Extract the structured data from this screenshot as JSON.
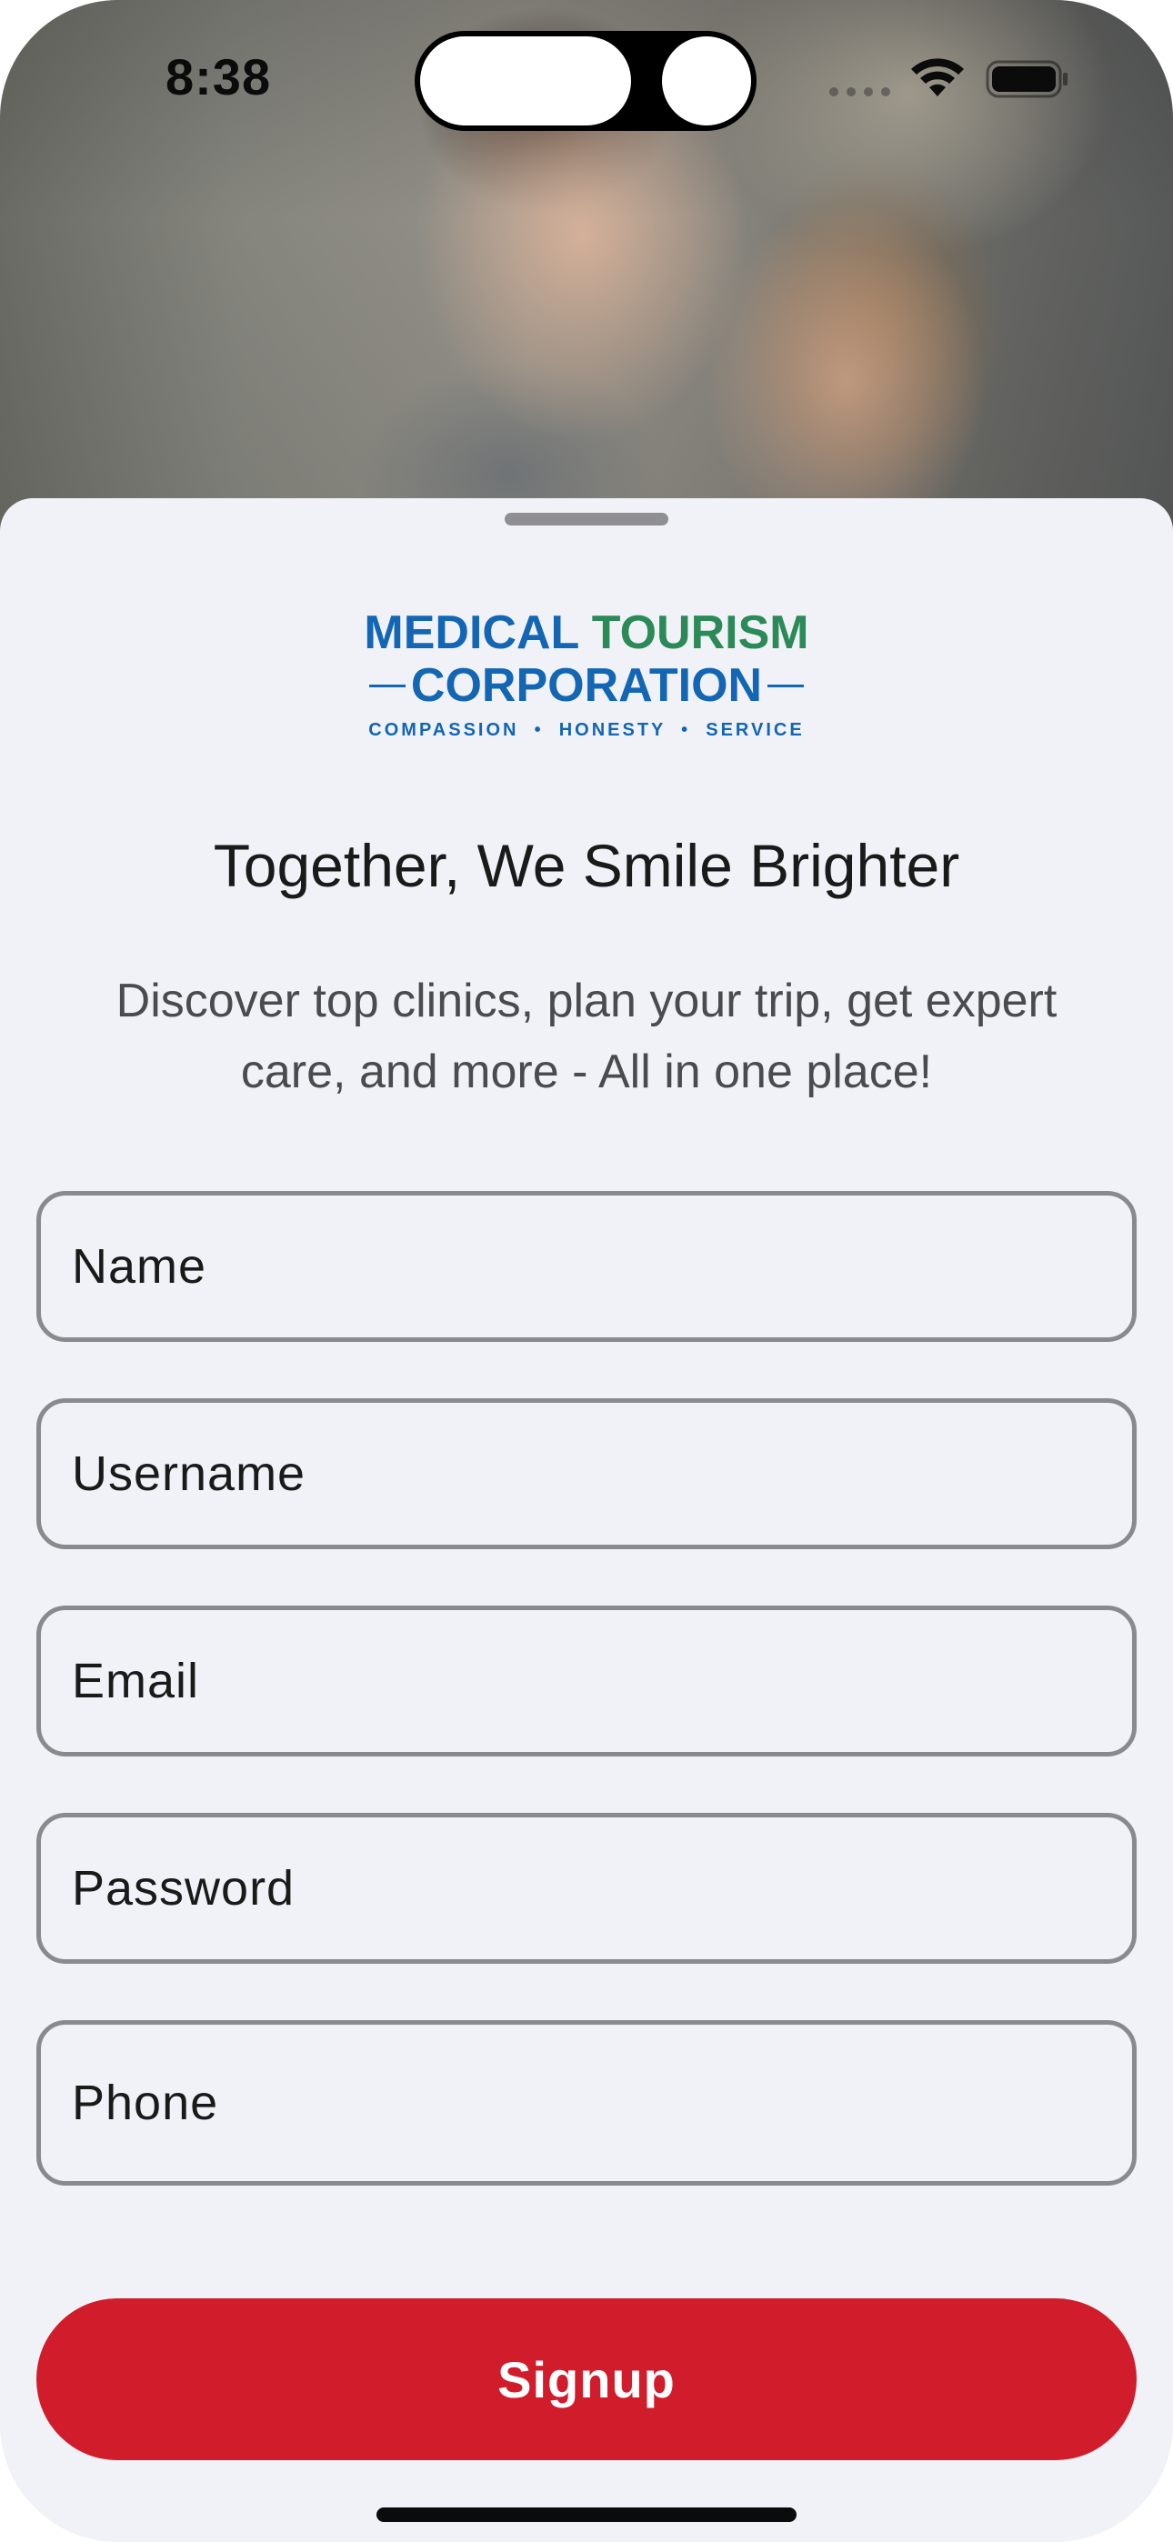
{
  "status_bar": {
    "time": "8:38",
    "icons": [
      "signal-icon",
      "wifi-icon",
      "battery-icon"
    ]
  },
  "hero": {
    "image": "couple-smiling-photo"
  },
  "logo": {
    "line1_word1": "MEDICAL",
    "line1_word2": "TOURISM",
    "line2": "CORPORATION",
    "tagline": "COMPASSION  •  HONESTY  •  SERVICE",
    "colors": {
      "blue": "#1266b3",
      "green": "#2b8a57"
    }
  },
  "headline": "Together, We Smile Brighter",
  "subtitle": "Discover top clinics, plan your trip, get expert care, and more - All in one place!",
  "form": {
    "name_placeholder": "Name",
    "username_placeholder": "Username",
    "email_placeholder": "Email",
    "password_placeholder": "Password",
    "phone_placeholder": "Phone",
    "name_value": "",
    "username_value": "",
    "email_value": "",
    "password_value": "",
    "phone_value": ""
  },
  "signup_button": {
    "label": "Signup",
    "color": "#d01c2b"
  }
}
